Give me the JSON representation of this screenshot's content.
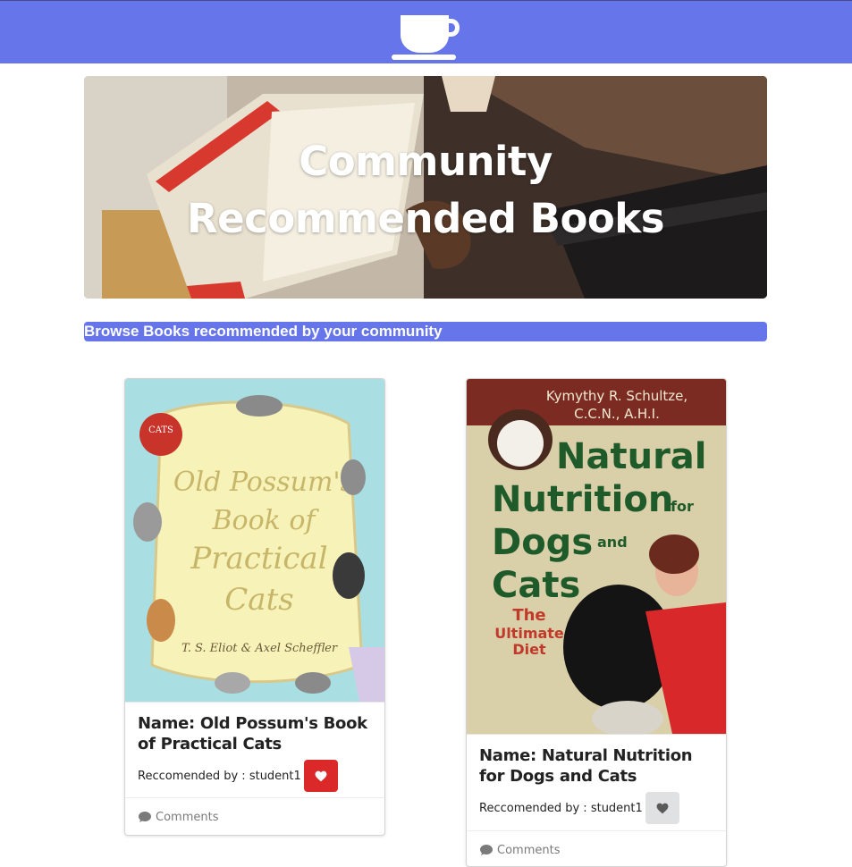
{
  "navbar": {
    "logo_icon": "coffee-cup-icon",
    "bg_color": "#6675ea"
  },
  "hero": {
    "title": "Community Recommended Books"
  },
  "browse": {
    "text": "Browse Books recommended by your community",
    "bg_color": "#6675ea"
  },
  "books": [
    {
      "name": "Name: Old Possum's Book of Practical Cats",
      "recommended_by": "Reccomended by : student1",
      "liked": true,
      "comments_label": "Comments",
      "cover_alt": "Old Possum's Book of Practical Cats",
      "cover_text": {
        "title_line1": "Old Possum's",
        "title_line2": "Book of",
        "title_line3": "Practical",
        "title_line4": "Cats",
        "author": "T. S. Eliot & Axel Scheffler",
        "badge": "CATS"
      }
    },
    {
      "name": "Name: Natural Nutrition for Dogs and Cats",
      "recommended_by": "Reccomended by : student1",
      "liked": false,
      "comments_label": "Comments",
      "cover_alt": "Natural Nutrition for Dogs and Cats",
      "cover_text": {
        "author": "Kymythy R. Schultze,",
        "credentials": "C.C.N., A.H.I.",
        "title_line1": "Natural",
        "title_line2": "Nutrition",
        "title_line3": "Dogs",
        "title_line4": "Cats",
        "for": "for",
        "and": "and",
        "subtitle1": "The",
        "subtitle2": "Ultimate",
        "subtitle3": "Diet"
      }
    }
  ],
  "colors": {
    "like_active": "#db2828",
    "like_inactive": "#e0e1e2",
    "accent": "#6675ea"
  }
}
